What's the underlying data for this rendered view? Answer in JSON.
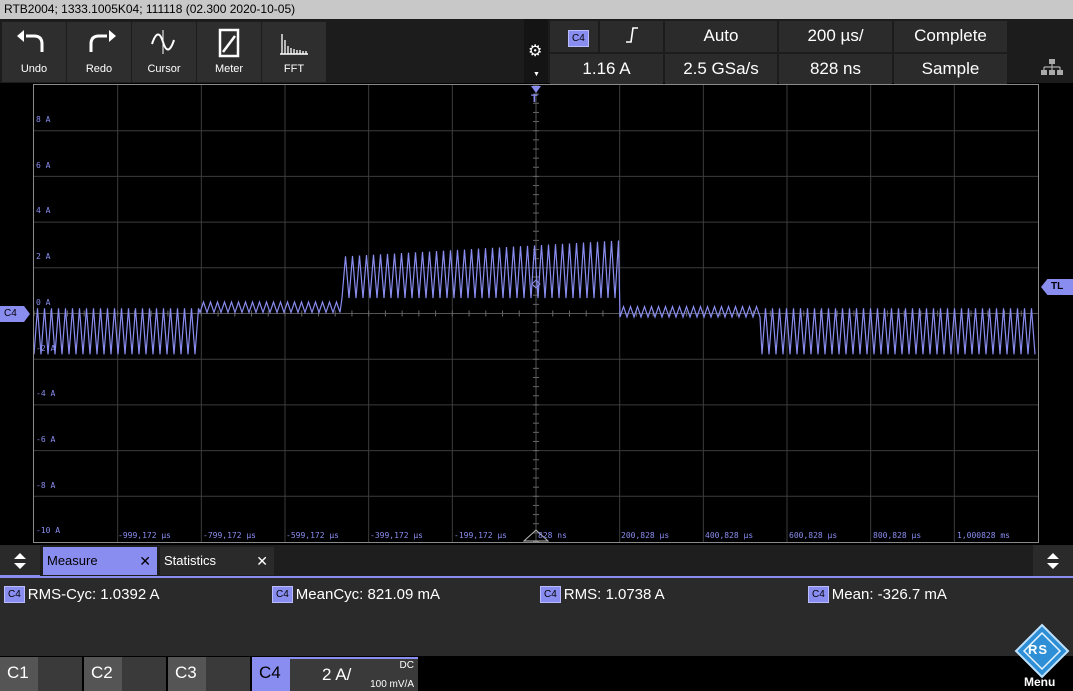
{
  "device_info": "RTB2004; 1333.1005K04; 111118 (02.300 2020-10-05)",
  "toolbar": {
    "buttons": [
      {
        "label": "Undo",
        "icon": "undo-icon"
      },
      {
        "label": "Redo",
        "icon": "redo-icon"
      },
      {
        "label": "Cursor",
        "icon": "cursor-icon"
      },
      {
        "label": "Meter",
        "icon": "meter-icon"
      },
      {
        "label": "FFT",
        "icon": "fft-icon"
      }
    ],
    "settings_icon": "gear-icon",
    "trigger": {
      "channel": "C4",
      "slope_icon": "rising-edge-icon",
      "level": "1.16 A"
    },
    "mode": "Auto",
    "sample_rate": "2.5 GSa/s",
    "timebase": "200 µs/",
    "record_length_time": "828 ns",
    "acquisition": "Complete",
    "acquisition_mode": "Sample",
    "network_icon": "network-icon"
  },
  "plot": {
    "trigger_marker": "T",
    "channel_marker": "C4",
    "trigger_level_marker": "TL",
    "y_labels": [
      "8 A",
      "6 A",
      "4 A",
      "2 A",
      "0 A",
      "-2 A",
      "-4 A",
      "-6 A",
      "-8 A",
      "-10 A"
    ],
    "x_labels": [
      "-999,172 µs",
      "-799,172 µs",
      "-599,172 µs",
      "-399,172 µs",
      "-199,172 µs",
      "828 ns",
      "200,828 µs",
      "400,828 µs",
      "600,828 µs",
      "800,828 µs",
      "1,000828 ms"
    ],
    "trace_color": "#8a8df0"
  },
  "measure_panel": {
    "tabs": [
      {
        "label": "Measure",
        "active": true
      },
      {
        "label": "Statistics",
        "active": false
      }
    ],
    "close_symbol": "✕",
    "measurements": [
      {
        "channel": "C4",
        "text": "RMS-Cyc: 1.0392 A"
      },
      {
        "channel": "C4",
        "text": "MeanCyc: 821.09 mA"
      },
      {
        "channel": "C4",
        "text": "RMS: 1.0738 A"
      },
      {
        "channel": "C4",
        "text": "Mean: -326.7 mA"
      }
    ]
  },
  "channels": {
    "c1": "C1",
    "c2": "C2",
    "c3": "C3",
    "c4": "C4",
    "c4_scale": "2 A/",
    "c4_coupling": "DC",
    "c4_probe": "100 mV/A"
  },
  "menu": {
    "label": "Menu",
    "logo_text": "RS"
  }
}
